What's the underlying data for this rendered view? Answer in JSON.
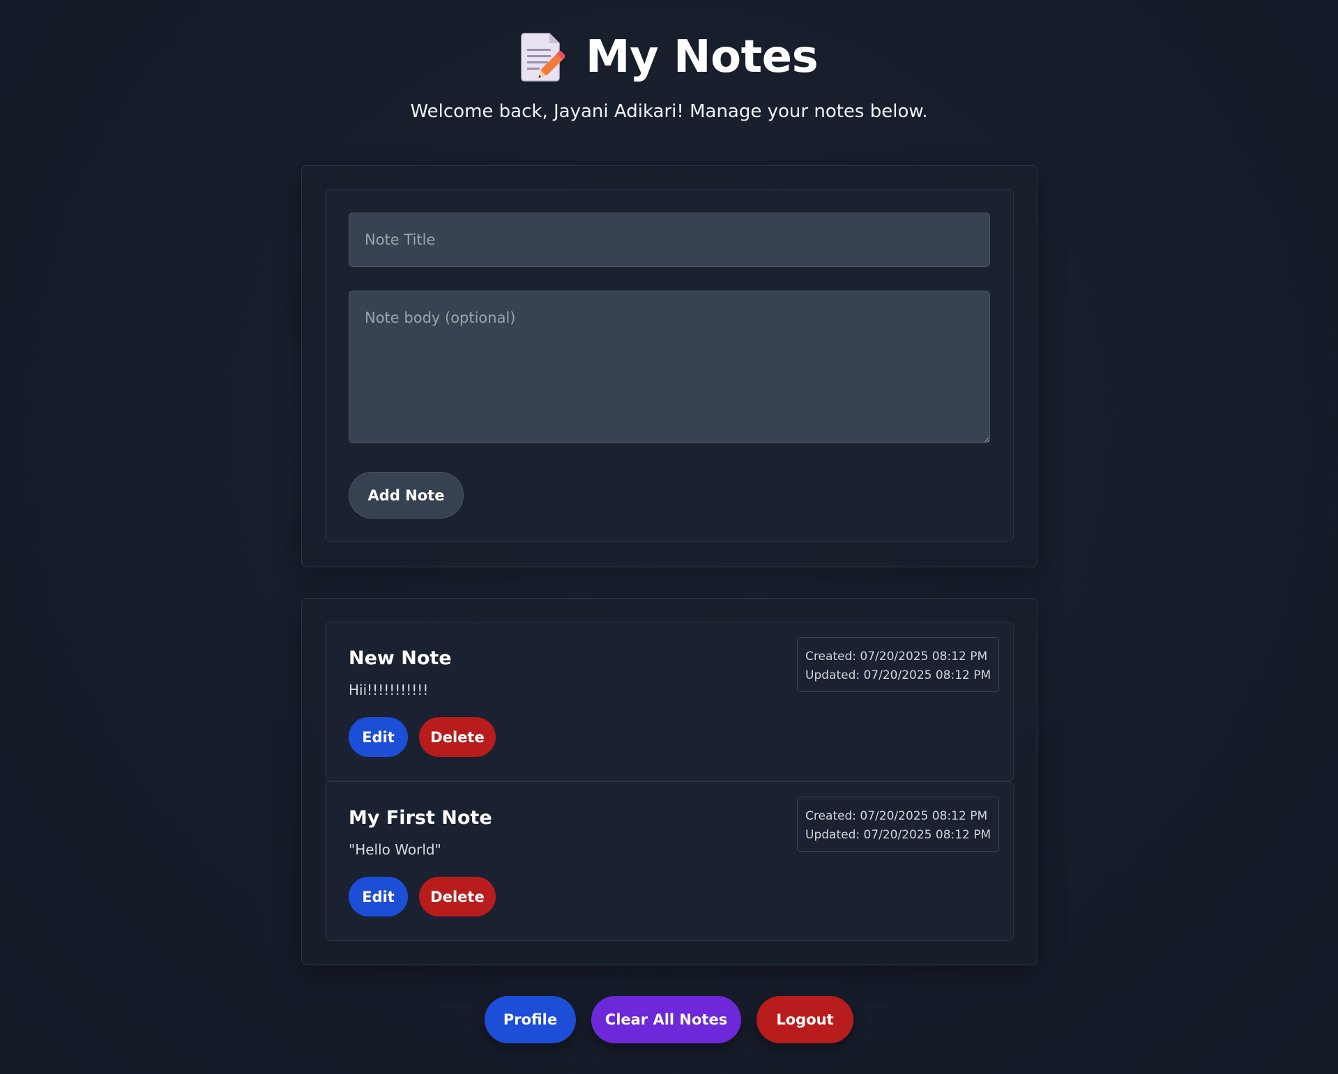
{
  "header": {
    "icon": "memo-icon",
    "title": "My Notes",
    "subtitle": "Welcome back, Jayani Adikari! Manage your notes below."
  },
  "form": {
    "title_placeholder": "Note Title",
    "title_value": "",
    "body_placeholder": "Note body (optional)",
    "body_value": "",
    "add_label": "Add Note"
  },
  "notes": [
    {
      "title": "New Note",
      "body": "Hii!!!!!!!!!!!",
      "created": "Created: 07/20/2025 08:12 PM",
      "updated": "Updated: 07/20/2025 08:12 PM",
      "edit_label": "Edit",
      "delete_label": "Delete"
    },
    {
      "title": "My First Note",
      "body": "\"Hello World\"",
      "created": "Created: 07/20/2025 08:12 PM",
      "updated": "Updated: 07/20/2025 08:12 PM",
      "edit_label": "Edit",
      "delete_label": "Delete"
    }
  ],
  "footer": {
    "profile_label": "Profile",
    "clear_label": "Clear All Notes",
    "logout_label": "Logout"
  },
  "colors": {
    "background": "#161d2a",
    "input_bg": "#394252",
    "edit_blue": "#1d4ed8",
    "delete_red": "#b91c1c",
    "clear_purple": "#6d28d9",
    "add_gray": "#374151"
  }
}
